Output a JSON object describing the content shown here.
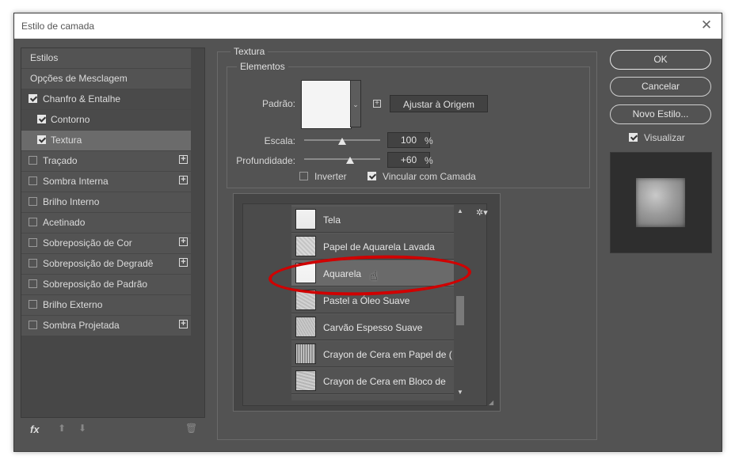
{
  "window": {
    "title": "Estilo de camada",
    "close_glyph": "✕"
  },
  "left_panel": {
    "items": [
      {
        "label": "Estilos",
        "checkbox": null,
        "plus": false
      },
      {
        "label": "Opções de Mesclagem",
        "checkbox": null,
        "plus": false
      },
      {
        "label": "Chanfro & Entalhe",
        "checkbox": true,
        "plus": false
      },
      {
        "label": "Contorno",
        "checkbox": true,
        "plus": false
      },
      {
        "label": "Textura",
        "checkbox": true,
        "plus": false
      },
      {
        "label": "Traçado",
        "checkbox": false,
        "plus": true
      },
      {
        "label": "Sombra Interna",
        "checkbox": false,
        "plus": true
      },
      {
        "label": "Brilho Interno",
        "checkbox": false,
        "plus": false
      },
      {
        "label": "Acetinado",
        "checkbox": false,
        "plus": false
      },
      {
        "label": "Sobreposição de Cor",
        "checkbox": false,
        "plus": true
      },
      {
        "label": "Sobreposição de Degradê",
        "checkbox": false,
        "plus": true
      },
      {
        "label": "Sobreposição de Padrão",
        "checkbox": false,
        "plus": false
      },
      {
        "label": "Brilho Externo",
        "checkbox": false,
        "plus": false
      },
      {
        "label": "Sombra Projetada",
        "checkbox": false,
        "plus": true
      }
    ],
    "footer": {
      "fx": "fx",
      "up": "⬆",
      "down": "⬇",
      "trash": "🗑"
    }
  },
  "texture": {
    "group_title": "Textura",
    "subgroup_title": "Elementos",
    "pattern_label": "Padrão:",
    "snap_button": "Ajustar à Origem",
    "scale_label": "Escala:",
    "scale_value": "100",
    "scale_unit": "%",
    "scale_fraction": 0.5,
    "depth_label": "Profundidade:",
    "depth_value": "+60",
    "depth_unit": "%",
    "depth_fraction": 0.6,
    "invert_label": "Inverter",
    "invert_checked": false,
    "link_label": "Vincular com Camada",
    "link_checked": true
  },
  "pattern_list": {
    "items": [
      {
        "name": "Tela",
        "selected": false
      },
      {
        "name": "Papel de Aquarela Lavada",
        "selected": false
      },
      {
        "name": "Aquarela",
        "selected": true
      },
      {
        "name": "Pastel a Óleo Suave",
        "selected": false
      },
      {
        "name": "Carvão Espesso Suave",
        "selected": false
      },
      {
        "name": "Crayon de Cera em Papel de (",
        "selected": false
      },
      {
        "name": "Crayon de Cera em Bloco de",
        "selected": false
      }
    ],
    "gear_glyph": "✲▾",
    "highlight_color": "#d00000"
  },
  "actions": {
    "ok": "OK",
    "cancel": "Cancelar",
    "new_style": "Novo Estilo...",
    "preview_label": "Visualizar",
    "preview_checked": true
  }
}
